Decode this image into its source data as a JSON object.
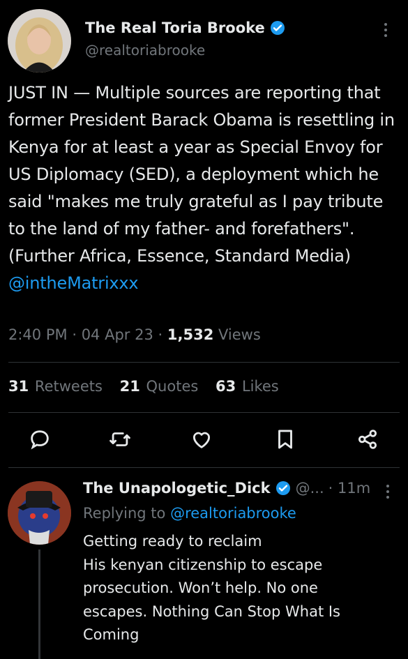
{
  "tweet": {
    "author_name": "The Real Toria Brooke",
    "author_handle": "@realtoriabrooke",
    "text": "JUST IN — Multiple sources are reporting that former President Barack Obama is resettling in Kenya for at least a year as Special Envoy for US Diplomacy (SED), a deployment which he said \"makes me truly grateful as I pay tribute to the land of my father- and forefathers\". (Further Africa, Essence, Standard Media) ",
    "mention": "@intheMatrixxx",
    "time": "2:40 PM",
    "date": "04 Apr 23",
    "views_count": "1,532",
    "views_label": "Views",
    "separator": "·"
  },
  "stats": {
    "retweets_count": "31",
    "retweets_label": "Retweets",
    "quotes_count": "21",
    "quotes_label": "Quotes",
    "likes_count": "63",
    "likes_label": "Likes"
  },
  "actions": [
    "reply-icon",
    "retweet-icon",
    "like-icon",
    "bookmark-icon",
    "share-icon"
  ],
  "reply": {
    "author_name": "The Unapologetic_Dick",
    "handle": "@...",
    "time": "· 11m",
    "replying_label": "Replying to",
    "replying_handle": "@realtoriabrooke",
    "text_lines": [
      "Getting ready to reclaim",
      "His kenyan citizenship to escape",
      "prosecution. Won’t help. No one",
      "escapes. Nothing Can Stop What Is",
      "Coming"
    ]
  },
  "colors": {
    "background": "#000000",
    "text": "#e7e9ea",
    "muted": "#71767b",
    "link": "#1d9bf0",
    "divider": "#2f3336"
  }
}
